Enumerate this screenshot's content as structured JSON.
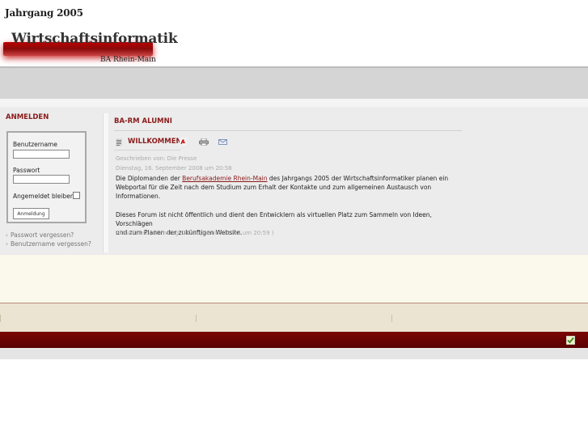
{
  "header": {
    "jahrgang": "Jahrgang 2005",
    "logo_title": "Wirtschaftsinformatik",
    "logo_subtitle": "BA Rhein-Main"
  },
  "login": {
    "heading": "ANMELDEN",
    "username_label": "Benutzername",
    "username_value": "",
    "password_label": "Passwort",
    "password_value": "",
    "remember_label": "Angemeldet bleiben",
    "remember_checked": false,
    "submit_label": "Anmeldung",
    "links": [
      {
        "label": "Passwort vergessen?"
      },
      {
        "label": "Benutzername vergessen?"
      }
    ]
  },
  "main": {
    "section_title": "BA-RM ALUMNI",
    "article": {
      "title": "WILLKOMMEN",
      "author": "Geschrieben von: Die Presse",
      "date": "Dienstag, 16. September 2008 um 20:58",
      "para1_before_link": "Die Diplomanden der ",
      "para1_link": "Berufsakademie Rhein-Main",
      "para1_after_link": " des Jahrgangs 2005 der Wirtschaftsinformatiker planen ein",
      "para1_line2": "Webportal für die Zeit nach dem Studium zum Erhalt der Kontakte und zum allgemeinen Austausch von",
      "para1_line3": "Informationen.",
      "para2_line1": "Dieses Forum ist nicht öffentlich und dient den Entwicklern als virtuellen Platz zum Sammeln von Ideen, Vorschlägen",
      "para2_line2": "und zum Planen der zukünftigen Website.",
      "updated": "Aktualisiert ( Dienstag, 16. September 2008 um 20:59 )"
    },
    "icons": [
      "document-icon",
      "pdf-icon",
      "print-icon",
      "email-icon"
    ]
  },
  "footer": {
    "badge_icon": "checkmark-icon"
  },
  "colors": {
    "accent": "#8b1a1a",
    "dark_bar": "#6a0303",
    "grey_bar": "#d5d5d5",
    "beige": "#fbf8ec"
  }
}
